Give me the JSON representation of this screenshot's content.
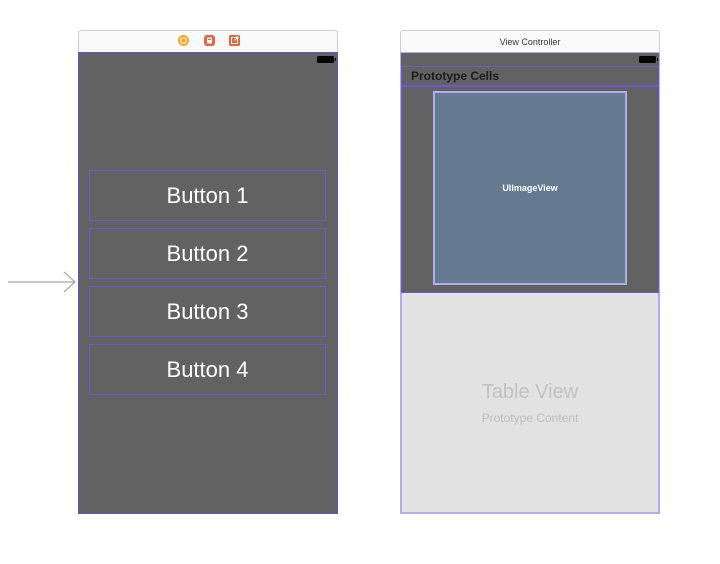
{
  "scene_1": {
    "buttons": [
      {
        "label": "Button 1"
      },
      {
        "label": "Button 2"
      },
      {
        "label": "Button 3"
      },
      {
        "label": "Button 4"
      }
    ],
    "dock_icons": [
      "view-controller-icon",
      "first-responder-icon",
      "exit-icon"
    ]
  },
  "scene_2": {
    "title": "View Controller",
    "prototype_cells_label": "Prototype Cells",
    "image_view_label": "UIImageView",
    "table_view_title": "Table View",
    "table_view_subtitle": "Prototype Content"
  },
  "colors": {
    "view_background": "#626262",
    "selection_outline": "#6e56d4",
    "table_background": "#e2e2e2",
    "image_view_fill": "#657991",
    "vc_icon": "#f5a623",
    "first_responder_icon": "#e8643c",
    "exit_icon": "#e8643c"
  }
}
